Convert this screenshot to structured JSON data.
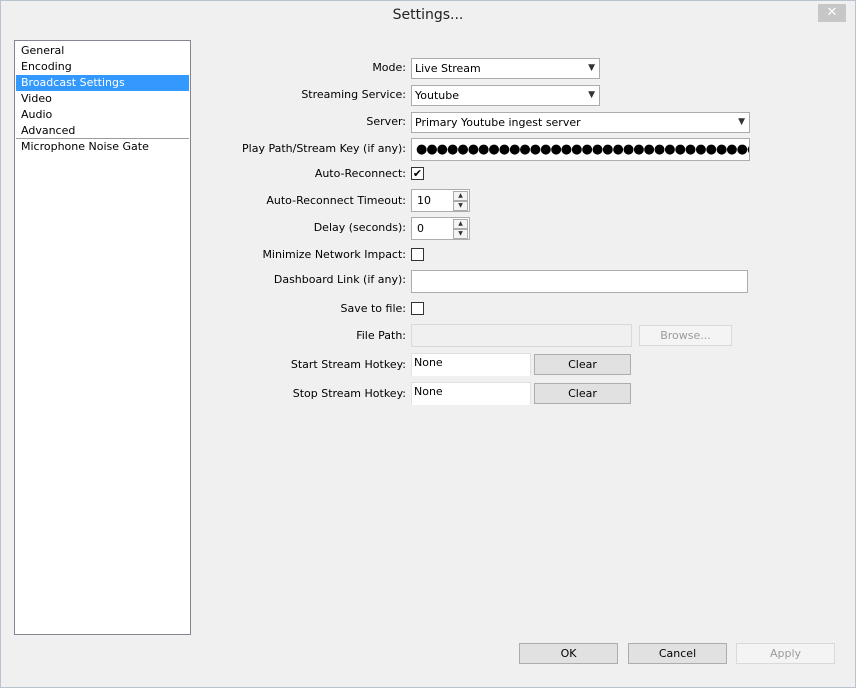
{
  "window": {
    "title": "Settings...",
    "close_glyph": "✕"
  },
  "sidebar": {
    "items": [
      {
        "label": "General"
      },
      {
        "label": "Encoding"
      },
      {
        "label": "Broadcast Settings",
        "selected": true
      },
      {
        "label": "Video"
      },
      {
        "label": "Audio"
      },
      {
        "label": "Advanced"
      },
      {
        "label": "Microphone Noise Gate"
      }
    ]
  },
  "form": {
    "mode": {
      "label": "Mode:",
      "value": "Live Stream"
    },
    "service": {
      "label": "Streaming Service:",
      "value": "Youtube"
    },
    "server": {
      "label": "Server:",
      "value": "Primary Youtube ingest server"
    },
    "stream_key": {
      "label": "Play Path/Stream Key (if any):",
      "value": "●●●●●●●●●●●●●●●●●●●●●●●●●●●●●●●●●●●●●●●●●●"
    },
    "auto_reconnect": {
      "label": "Auto-Reconnect:",
      "checked": true,
      "glyph": "✔"
    },
    "reconnect_timeout": {
      "label": "Auto-Reconnect Timeout:",
      "value": "10"
    },
    "delay": {
      "label": "Delay (seconds):",
      "value": "0"
    },
    "minimize_impact": {
      "label": "Minimize Network Impact:",
      "checked": false
    },
    "dashboard_link": {
      "label": "Dashboard Link (if any):",
      "value": ""
    },
    "save_to_file": {
      "label": "Save to file:",
      "checked": false
    },
    "file_path": {
      "label": "File Path:",
      "value": "",
      "browse_label": "Browse..."
    },
    "start_hotkey": {
      "label": "Start Stream Hotkey:",
      "value": "None",
      "clear_label": "Clear"
    },
    "stop_hotkey": {
      "label": "Stop Stream Hotkey:",
      "value": "None",
      "clear_label": "Clear"
    }
  },
  "footer": {
    "ok_label": "OK",
    "cancel_label": "Cancel",
    "apply_label": "Apply"
  },
  "colors": {
    "selection": "#3399ff",
    "window_bg": "#f0f0f0"
  }
}
